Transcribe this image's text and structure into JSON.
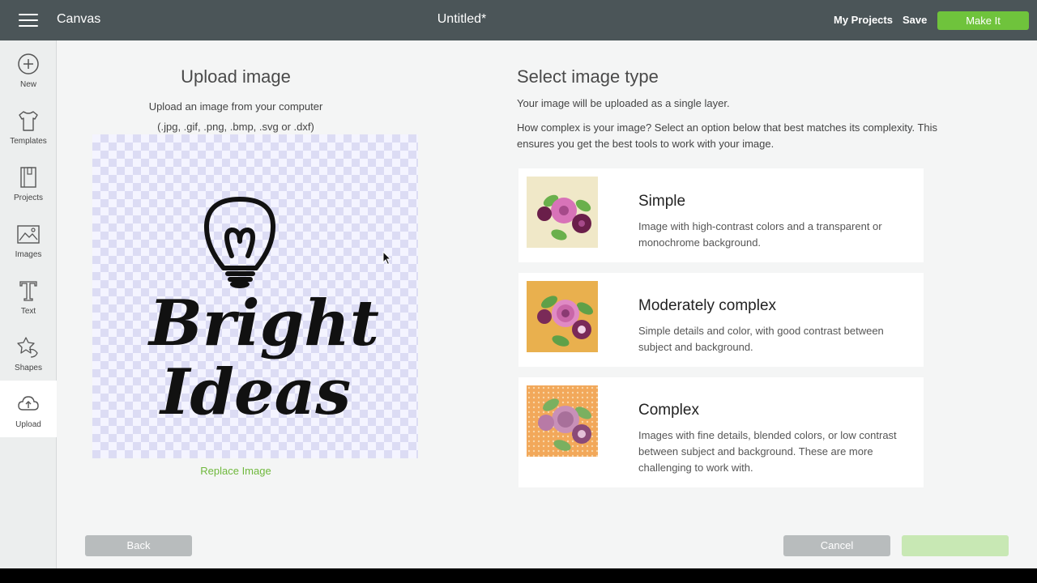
{
  "topbar": {
    "app_name": "Canvas",
    "doc_title": "Untitled*",
    "my_projects": "My Projects",
    "save": "Save",
    "make_it": "Make It"
  },
  "sidebar": {
    "items": [
      {
        "label": "New",
        "icon": "plus-circle-icon"
      },
      {
        "label": "Templates",
        "icon": "tshirt-icon"
      },
      {
        "label": "Projects",
        "icon": "notebook-icon"
      },
      {
        "label": "Images",
        "icon": "image-icon"
      },
      {
        "label": "Text",
        "icon": "text-icon"
      },
      {
        "label": "Shapes",
        "icon": "shapes-icon"
      },
      {
        "label": "Upload",
        "icon": "cloud-upload-icon"
      }
    ]
  },
  "upload": {
    "title": "Upload image",
    "subtitle_line1": "Upload an image from your computer",
    "subtitle_line2": "(.jpg, .gif, .png, .bmp, .svg or .dxf)",
    "preview_text_line1": "Bright",
    "preview_text_line2": "Ideas",
    "replace_link": "Replace Image"
  },
  "image_type": {
    "title": "Select image type",
    "desc1": "Your image will be uploaded as a single layer.",
    "desc2": "How complex is your image? Select an option below that best matches its complexity. This ensures you get the best tools to work with your image.",
    "options": [
      {
        "title": "Simple",
        "desc": "Image with high-contrast colors and a transparent or monochrome background.",
        "thumb_bg": "#f0e8c8"
      },
      {
        "title": "Moderately complex",
        "desc": "Simple details and color, with good contrast between subject and background.",
        "thumb_bg": "#e9b04e"
      },
      {
        "title": "Complex",
        "desc": "Images with fine details, blended colors, or low contrast between subject and background. These are more challenging to work with.",
        "thumb_bg": "#f2a85a"
      }
    ]
  },
  "footer": {
    "back": "Back",
    "cancel": "Cancel",
    "next": ""
  },
  "colors": {
    "topbar": "#4b5558",
    "accent_green": "#6fc33c",
    "link_green": "#6fb83c"
  }
}
